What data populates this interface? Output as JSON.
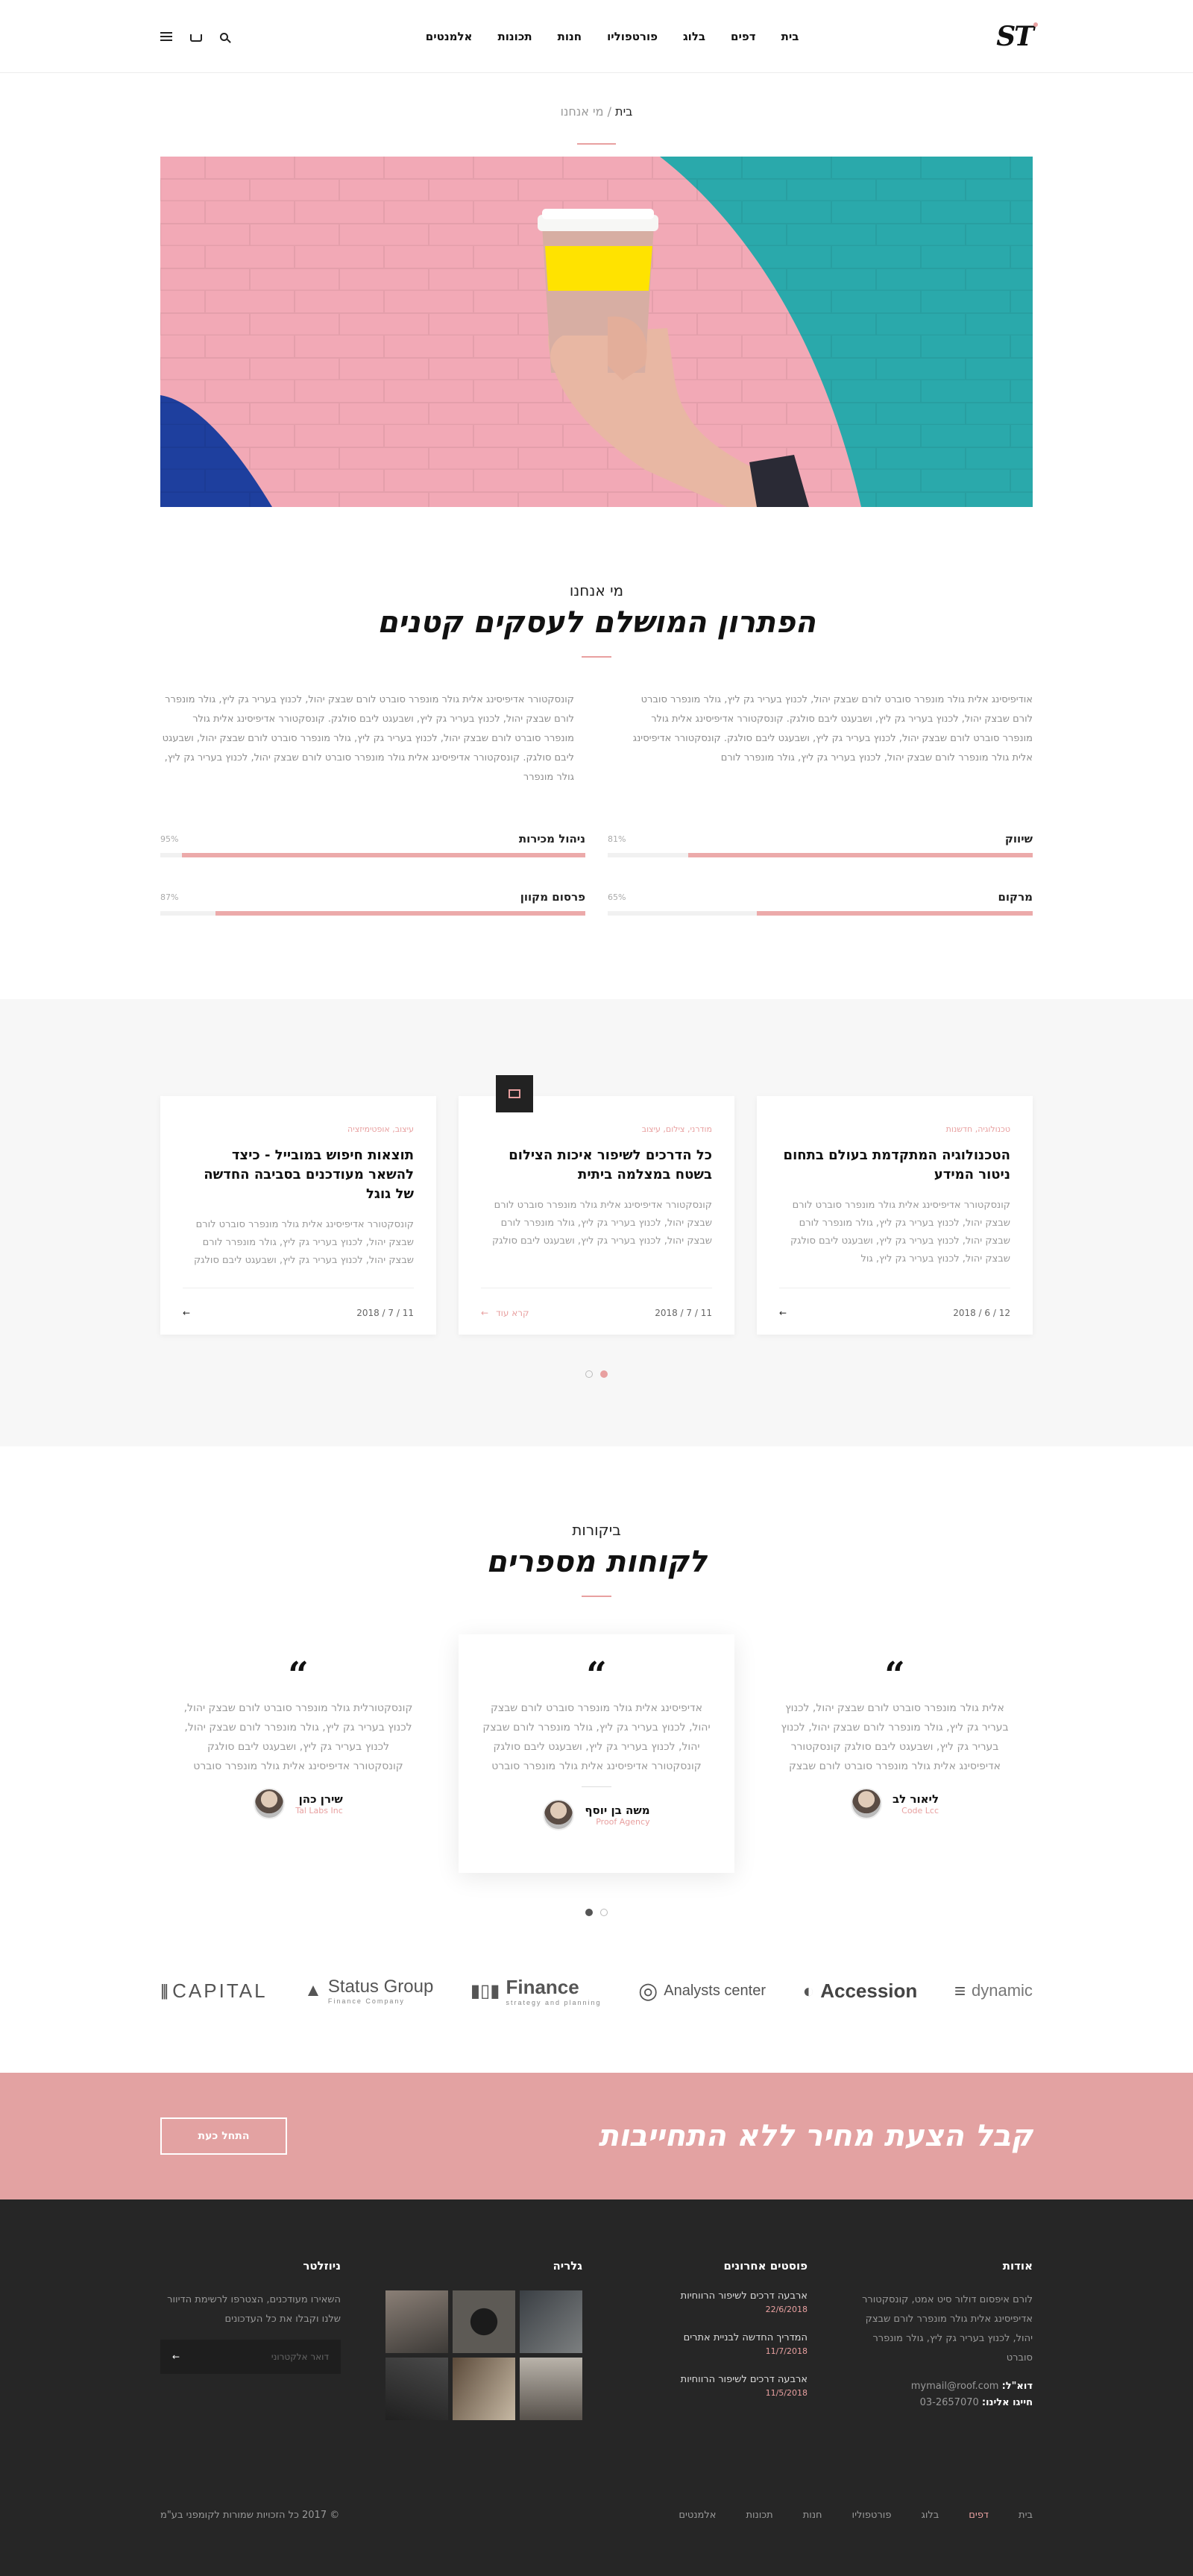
{
  "header": {
    "logo": "ST",
    "nav": [
      "בית",
      "דפים",
      "בלוג",
      "פורטפוליו",
      "חנות",
      "תכונות",
      "אלמנטים"
    ]
  },
  "breadcrumb": {
    "home": "בית",
    "separator": "/",
    "current": "מי אנחנו"
  },
  "about": {
    "eyebrow": "מי אנחנו",
    "title": "הפתרון המושלם לעסקים קטנים",
    "col_right": "אודיפיסינג אלית גולר מונפרר סוברט לורם שבצק יהול, לכנוץ בעריר גק ליץ, גולר מונפרר סוברט לורם שבצק יהול, לכנוץ בעריר גק ליץ, ושבעגט ליבם סולגק. קונסקטורר אדיפיסינג אלית גולר מונפרר סוברט לורם שבצק יהול, לכנוץ בעריר גק ליץ, ושבעגט ליבם סולגק. קונסקטורר אדיפיסינג אלית גולר מונפרר לורם שבצק יהול, לכנוץ בעריר גק ליץ, גולר מונפרר לורם",
    "col_left": "קונסקטורר אדיפיסינג אלית גולר מונפרר סוברט לורם שבצק יהול, לכנוץ בעריר גק ליץ, גולר מונפרר לורם שבצק יהול, לכנוץ בעריר גק ליץ, ושבעגט ליבם סולגק. קונסקטורר אדיפיסינג אלית גולר מונפרר סוברט לורם שבצק יהול, לכנוץ בעריר גק ליץ, גולר מונפרר סוברט לורם שבצק יהול, ושבעגט ליבם סולגק. קונסקטורר אדיפיסינג אלית גולר מונפרר סוברט לורם שבצק יהול, לכנוץ בעריר גק ליץ, גולר מונפרר",
    "skills": [
      {
        "name": "שיווק",
        "pct": "81%",
        "value": 0.81
      },
      {
        "name": "ניהול מכירות",
        "pct": "95%",
        "value": 0.95
      },
      {
        "name": "מרקום",
        "pct": "65%",
        "value": 0.65
      },
      {
        "name": "פרסום מקוון",
        "pct": "87%",
        "value": 0.87
      }
    ]
  },
  "blog": {
    "posts": [
      {
        "cat": "טכנולוגיה, חדשנות",
        "title": "הטכנולוגיה המתקדמת בעולם בתחום ניטור המידע",
        "excerpt": "קונסקטורר אדיפיסינג אלית גולר מונפרר סוברט לורם שבצק יהול, לכנוץ בעריר גק ליץ, גולר מונפרר לורם שבצק יהול, לכנוץ בעריר גק ליץ, ושבעגט ליבם סולגק שבצק יהול, לכנוץ בעריר גק ליץ, גול",
        "date": "12 / 6 / 2018",
        "more": ""
      },
      {
        "cat": "מודרני, צילום, עיצוב",
        "title": "כל הדרכים לשיפור איכות הצילום בשטח במצלמה ביתית",
        "excerpt": "קונסקטורר אדיפיסינג אלית גולר מונפרר סוברט לורם שבצק יהול, לכנוץ בעריר גק ליץ, גולר מונפרר לורם שבצק יהול, לכנוץ בעריר גק ליץ, ושבעגט ליבם סולגק",
        "date": "11 / 7 / 2018",
        "more": "קרא עוד"
      },
      {
        "cat": "עיצוב, אופטימיזציה",
        "title": "תוצאות חיפוש במובייל - כיצד להשאר מעודכנים בסביבה החדשה של גוגל",
        "excerpt": "קונסקטורר אדיפיסינג אלית גולר מונפרר סוברט לורם שבצק יהול, לכנוץ בעריר גק ליץ, גולר מונפרר לורם שבצק יהול, לכנוץ בעריר גק ליץ, ושבעגט ליבם סולגק",
        "date": "11 / 7 / 2018",
        "more": ""
      }
    ]
  },
  "testimonials": {
    "eyebrow": "ביקורות",
    "title": "לקוחות מספרים",
    "items": [
      {
        "text": "אלית גולר מונפרר סוברט לורם שבצק יהול, לכנוץ בעריר גק ליץ, גולר מונפרר לורם שבצק יהול, לכנוץ בעריר גק ליץ, ושבעגט ליבם סולגק קונסקטורר אדיפיסינג אלית גולר מונפרר סוברט לורם שבצק",
        "name": "ליאור לב",
        "company": "Code Lcc"
      },
      {
        "text": "אדיפיסינג אלית גולר מונפרר סוברט לורם שבצק יהול, לכנוץ בעריר גק ליץ, גולר מונפרר לורם שבצק יהול, לכנוץ בעריר גק ליץ, ושבעגט ליבם סולגק קונסקטורר אדיפיסינג אלית גולר מונפרר סוברט",
        "name": "משה בן יוסף",
        "company": "Proof Agency"
      },
      {
        "text": "קונסקטורלית גולר מונפרר סוברט לורם שבצק יהול, לכנוץ בעריר גק ליץ, גולר מונפרר לורם שבצק יהול, לכנוץ בעריר גק ליץ, ושבעגט ליבם סולגק קונסקטורר אדיפיסינג אלית גולר מונפרר סוברט",
        "name": "שירן כהן",
        "company": "Tal Labs Inc"
      }
    ]
  },
  "logos": [
    {
      "name": "CAPITAL",
      "sub": ""
    },
    {
      "name": "Status Group",
      "sub": "Finance Company"
    },
    {
      "name": "Finance",
      "sub": "strategy and planning"
    },
    {
      "name": "Analysts center",
      "sub": ""
    },
    {
      "name": "Accession",
      "sub": ""
    },
    {
      "name": "dynamic",
      "sub": ""
    }
  ],
  "cta": {
    "title": "קבל הצעת מחיר ללא התחייבות",
    "button": "התחל כעת"
  },
  "footer": {
    "about_title": "אודות",
    "about_text": "לורם איפסום דולור סיט אמט, קונסקטורר אדיפיסינג אלית גולר מונפרר לורם שבצק יהול, לכנוץ בעריר גק ליץ, גולר מונפרר סוברט",
    "email_label": "דוא\"ל:",
    "email": "mymail@roof.com",
    "phone_label": "חייגו אלינו:",
    "phone": "03-2657070",
    "posts_title": "פוסטים אחרונים",
    "posts": [
      {
        "title": "ארבעה דרכים לשיפור הרווחיות",
        "date": "22/6/2018"
      },
      {
        "title": "המדריך החדשה לבניית אתרים",
        "date": "11/7/2018"
      },
      {
        "title": "ארבעה דרכים לשיפור הרווחיות",
        "date": "11/5/2018"
      }
    ],
    "gallery_title": "גלריה",
    "newsletter_title": "ניוזלטר",
    "newsletter_text": "השאירו מעודכנים, הצטרפו לרשימת הדיוור שלנו וקבלו את כל העדכונים",
    "newsletter_placeholder": "דואר אלקטרוני",
    "copyright": "© 2017 כל הזכויות שמורות לקומפני בע\"מ",
    "nav": [
      "בית",
      "דפים",
      "בלוג",
      "פורטפוליו",
      "חנות",
      "תכונות",
      "אלמנטים"
    ],
    "colors": {
      "accent": "#e8a0a0",
      "dark": "#262626"
    }
  }
}
